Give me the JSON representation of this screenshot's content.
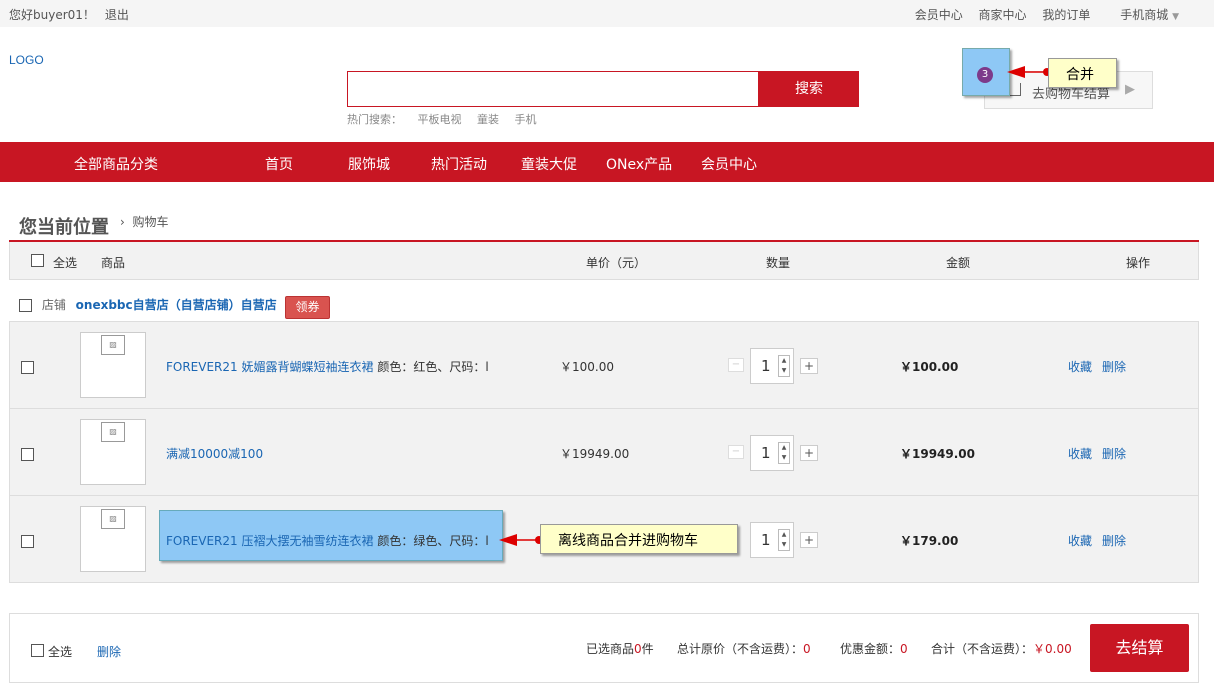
{
  "topbar": {
    "greeting": "您好buyer01！",
    "logout": "退出",
    "member_center": "会员中心",
    "seller_center": "商家中心",
    "my_orders": "我的订单",
    "mobile_mall": "手机商城"
  },
  "header": {
    "logo": "LOGO",
    "search_placeholder": "",
    "search_button": "搜索",
    "hot_label": "热门搜索：",
    "hot_terms": [
      "平板电视",
      "童装",
      "手机"
    ],
    "cart_button": "去购物车结算"
  },
  "annotations": {
    "merge_badge": "3",
    "merge_label": "合并",
    "offline_label": "离线商品合并进购物车"
  },
  "nav": {
    "items": [
      "全部商品分类",
      "首页",
      "服饰城",
      "热门活动",
      "童装大促",
      "ONex产品",
      "会员中心"
    ]
  },
  "breadcrumb": {
    "title": "您当前位置",
    "current": "购物车"
  },
  "table": {
    "select_all": "全选",
    "col_product": "商品",
    "col_price": "单价（元）",
    "col_qty": "数量",
    "col_amount": "金额",
    "col_ops": "操作"
  },
  "shop": {
    "label": "店铺",
    "name": "onexbbc自营店（自营店铺）自营店",
    "coupon": "领券"
  },
  "items": [
    {
      "name": "FOREVER21 妩媚露背蝴蝶短袖连衣裙",
      "spec": "颜色：红色、尺码：l",
      "price": "￥100.00",
      "qty": "1",
      "amount": "￥100.00",
      "fav": "收藏",
      "del": "删除"
    },
    {
      "name": "满减10000减100",
      "spec": "",
      "price": "￥19949.00",
      "qty": "1",
      "amount": "￥19949.00",
      "fav": "收藏",
      "del": "删除"
    },
    {
      "name": "FOREVER21 压褶大摆无袖雪纺连衣裙",
      "spec": "颜色：绿色、尺码：l",
      "price": "",
      "qty": "1",
      "amount": "￥179.00",
      "fav": "收藏",
      "del": "删除"
    }
  ],
  "footer": {
    "select_all": "全选",
    "delete": "删除",
    "selected_prefix": "已选商品",
    "selected_count": "0",
    "selected_suffix": "件",
    "orig_label": "总计原价（不含运费）：",
    "orig_value": "0",
    "discount_label": "优惠金额：",
    "discount_value": "0",
    "total_label": "合计（不含运费）：",
    "total_value": "￥0.00",
    "checkout": "去结算"
  },
  "colors": {
    "brand": "#c81623",
    "link": "#1a66b3",
    "note": "#ffffc9",
    "highlight": "#8ec8f5"
  }
}
